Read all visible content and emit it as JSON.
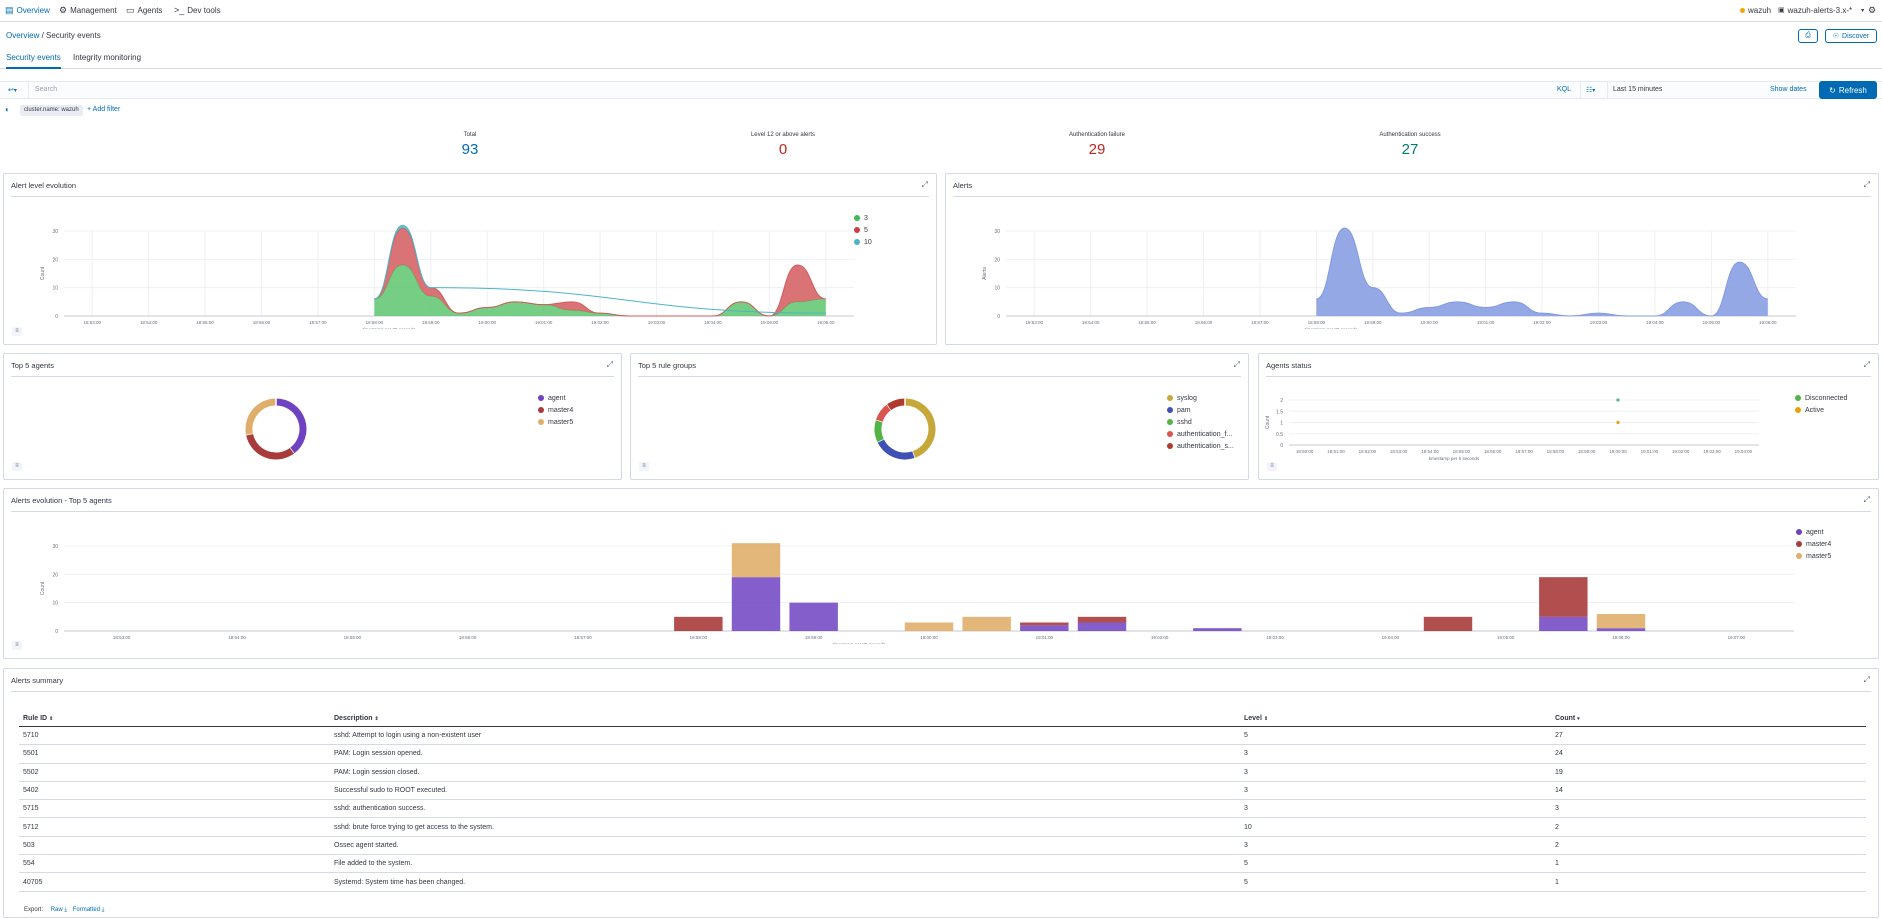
{
  "topnav": {
    "items": [
      {
        "label": "Overview",
        "icon": "overview-icon"
      },
      {
        "label": "Management",
        "icon": "management-icon"
      },
      {
        "label": "Agents",
        "icon": "agents-icon"
      },
      {
        "label": "Dev tools",
        "icon": "devtools-icon"
      }
    ],
    "api_label": "wazuh",
    "index_pattern": "wazuh-alerts-3.x-*"
  },
  "breadcrumb": {
    "root": "Overview",
    "separator": " / ",
    "current": "Security events"
  },
  "actions": {
    "discover_label": "Discover"
  },
  "tabs": [
    {
      "label": "Security events"
    },
    {
      "label": "Integrity monitoring"
    }
  ],
  "query": {
    "placeholder": "Search",
    "language": "KQL",
    "time_range": "Last 15 minutes",
    "show_dates": "Show dates",
    "refresh": "Refresh"
  },
  "filters": {
    "pill": "cluster.name: wazuh",
    "add": "+ Add filter"
  },
  "stats": [
    {
      "label": "Total",
      "value": "93",
      "color": "#006bb4"
    },
    {
      "label": "Level 12 or above alerts",
      "value": "0",
      "color": "#bd271e"
    },
    {
      "label": "Authentication failure",
      "value": "29",
      "color": "#bd271e"
    },
    {
      "label": "Authentication success",
      "value": "27",
      "color": "#017d73"
    }
  ],
  "panels": {
    "alert_level": {
      "title": "Alert level evolution"
    },
    "alerts": {
      "title": "Alerts"
    },
    "top_agents": {
      "title": "Top 5 agents"
    },
    "top_rulegroups": {
      "title": "Top 5 rule groups"
    },
    "agents_status": {
      "title": "Agents status"
    },
    "alerts_evolution": {
      "title": "Alerts evolution - Top 5 agents"
    },
    "summary": {
      "title": "Alerts summary"
    }
  },
  "colors": {
    "c3": "#54b399",
    "c5": "#d36086",
    "c10": "#6092c0",
    "agent": "#6f42c1",
    "master4": "#a83b3b",
    "master5": "#e0ae6b"
  },
  "chart_data": [
    {
      "type": "area",
      "title": "Alert level evolution",
      "xlabel": "timestamp per 30 seconds",
      "ylabel": "Count",
      "ylim": [
        0,
        30
      ],
      "y_ticks": [
        0,
        10,
        20,
        30
      ],
      "x_ticks": [
        "18:53:00",
        "18:54:00",
        "18:55:00",
        "18:56:00",
        "18:57:00",
        "18:58:00",
        "18:59:00",
        "19:00:00",
        "19:01:00",
        "19:02:00",
        "19:03:00",
        "19:04:00",
        "19:05:00",
        "19:06:00"
      ],
      "x_start_min": 0,
      "series": [
        {
          "name": "3",
          "color": "#54b399",
          "points": [
            [
              5,
              6
            ],
            [
              5.5,
              18
            ],
            [
              6,
              7
            ],
            [
              6.5,
              1
            ],
            [
              7,
              3
            ],
            [
              7.5,
              5
            ],
            [
              8,
              4
            ],
            [
              8.5,
              2
            ],
            [
              9,
              1
            ],
            [
              9.5,
              0
            ],
            [
              10,
              0
            ],
            [
              10.5,
              0
            ],
            [
              11,
              0
            ],
            [
              11.5,
              5
            ],
            [
              12,
              0
            ],
            [
              12.5,
              5
            ],
            [
              13,
              6
            ]
          ]
        },
        {
          "name": "5",
          "color": "#d36086",
          "points": [
            [
              5,
              0
            ],
            [
              5.5,
              13
            ],
            [
              6,
              3
            ],
            [
              6.5,
              0
            ],
            [
              7,
              0
            ],
            [
              7.5,
              0
            ],
            [
              8,
              0
            ],
            [
              8.5,
              3
            ],
            [
              9,
              0
            ],
            [
              9.5,
              0
            ],
            [
              10,
              0
            ],
            [
              10.5,
              0
            ],
            [
              11,
              0
            ],
            [
              11.5,
              0
            ],
            [
              12,
              0
            ],
            [
              12.5,
              13
            ],
            [
              13,
              0
            ]
          ]
        },
        {
          "name": "10",
          "color": "#6092c0",
          "points": [
            [
              5,
              0
            ],
            [
              5.5,
              1
            ],
            [
              6,
              0
            ],
            [
              13,
              0
            ]
          ]
        }
      ]
    },
    {
      "type": "area",
      "title": "Alerts",
      "xlabel": "timestamp per 30 seconds",
      "ylabel": "Alerts",
      "ylim": [
        0,
        30
      ],
      "y_ticks": [
        0,
        10,
        20,
        30
      ],
      "x_ticks": [
        "18:53:00",
        "18:54:00",
        "18:55:00",
        "18:56:00",
        "18:57:00",
        "18:58:00",
        "18:59:00",
        "19:00:00",
        "19:01:00",
        "19:02:00",
        "19:03:00",
        "19:04:00",
        "19:05:00",
        "19:06:00"
      ],
      "series": [
        {
          "name": "Count",
          "color": "#6092c0",
          "points": [
            [
              5,
              6
            ],
            [
              5.5,
              31
            ],
            [
              6,
              10
            ],
            [
              6.5,
              1
            ],
            [
              7,
              3
            ],
            [
              7.5,
              5
            ],
            [
              8,
              3
            ],
            [
              8.5,
              5
            ],
            [
              9,
              1
            ],
            [
              9.5,
              0
            ],
            [
              10,
              1
            ],
            [
              10.5,
              0
            ],
            [
              11,
              0
            ],
            [
              11.5,
              5
            ],
            [
              12,
              0
            ],
            [
              12.5,
              19
            ],
            [
              13,
              6
            ]
          ]
        }
      ]
    },
    {
      "type": "pie",
      "title": "Top 5 agents",
      "series": [
        {
          "name": "agent",
          "value": 40,
          "color": "#6f42c1"
        },
        {
          "name": "master4",
          "value": 32,
          "color": "#a83b3b"
        },
        {
          "name": "master5",
          "value": 28,
          "color": "#e0ae6b"
        }
      ]
    },
    {
      "type": "pie",
      "title": "Top 5 rule groups",
      "series": [
        {
          "name": "syslog",
          "value": 45,
          "color": "#c6a83a"
        },
        {
          "name": "pam",
          "value": 23,
          "color": "#3f51b5"
        },
        {
          "name": "sshd",
          "value": 12,
          "color": "#54b347"
        },
        {
          "name": "authentication_f...",
          "value": 10,
          "color": "#d9534f"
        },
        {
          "name": "authentication_s...",
          "value": 10,
          "color": "#b03a2e"
        }
      ]
    },
    {
      "type": "scatter",
      "title": "Agents status",
      "xlabel": "timestamp per 5 seconds",
      "ylabel": "Count",
      "ylim": [
        0,
        2
      ],
      "y_ticks": [
        0,
        0.5,
        1,
        1.5,
        2
      ],
      "x_ticks": [
        "18:50:00",
        "18:51:00",
        "18:52:00",
        "18:53:00",
        "18:54:00",
        "18:55:00",
        "18:56:00",
        "18:57:00",
        "18:58:00",
        "18:59:00",
        "19:00:00",
        "19:01:00",
        "19:02:00",
        "19:03:00",
        "19:04:00"
      ],
      "series": [
        {
          "name": "Disconnected",
          "color": "#54b399",
          "points": [
            [
              10,
              2
            ]
          ]
        },
        {
          "name": "Active",
          "color": "#e7a20b",
          "points": [
            [
              10,
              1
            ]
          ]
        }
      ]
    },
    {
      "type": "bar",
      "title": "Alerts evolution - Top 5 agents",
      "xlabel": "timestamp per 30 seconds",
      "ylabel": "Count",
      "ylim": [
        0,
        30
      ],
      "y_ticks": [
        0,
        10,
        20,
        30
      ],
      "x_ticks": [
        "18:53:00",
        "18:54:00",
        "18:55:00",
        "18:56:00",
        "18:57:00",
        "18:58:00",
        "18:59:00",
        "19:00:00",
        "19:01:00",
        "19:02:00",
        "19:03:00",
        "19:04:00",
        "19:05:00",
        "19:06:00",
        "19:07:00"
      ],
      "x": [
        5,
        5.5,
        6,
        7,
        7.5,
        8,
        8.5,
        9.5,
        11.5,
        12.5,
        13
      ],
      "series": [
        {
          "name": "agent",
          "color": "#6f42c1",
          "values": [
            0,
            19,
            10,
            0,
            0,
            2,
            3,
            1,
            0,
            5,
            1
          ]
        },
        {
          "name": "master4",
          "color": "#a83b3b",
          "values": [
            5,
            0,
            0,
            0,
            0,
            1,
            2,
            0,
            5,
            14,
            0
          ]
        },
        {
          "name": "master5",
          "color": "#e0ae6b",
          "values": [
            0,
            12,
            0,
            3,
            5,
            0,
            0,
            0,
            0,
            0,
            5
          ]
        }
      ]
    }
  ],
  "summary": {
    "columns": [
      "Rule ID",
      "Description",
      "Level",
      "Count"
    ],
    "rows": [
      [
        "5710",
        "sshd: Attempt to login using a non-existent user",
        "5",
        "27"
      ],
      [
        "5501",
        "PAM: Login session opened.",
        "3",
        "24"
      ],
      [
        "5502",
        "PAM: Login session closed.",
        "3",
        "19"
      ],
      [
        "5402",
        "Successful sudo to ROOT executed.",
        "3",
        "14"
      ],
      [
        "5715",
        "sshd: authentication success.",
        "3",
        "3"
      ],
      [
        "5712",
        "sshd: brute force trying to get access to the system.",
        "10",
        "2"
      ],
      [
        "503",
        "Ossec agent started.",
        "3",
        "2"
      ],
      [
        "554",
        "File added to the system.",
        "5",
        "1"
      ],
      [
        "40705",
        "Systemd: System time has been changed.",
        "5",
        "1"
      ]
    ],
    "export_label": "Export:",
    "raw_label": "Raw",
    "formatted_label": "Formatted"
  }
}
